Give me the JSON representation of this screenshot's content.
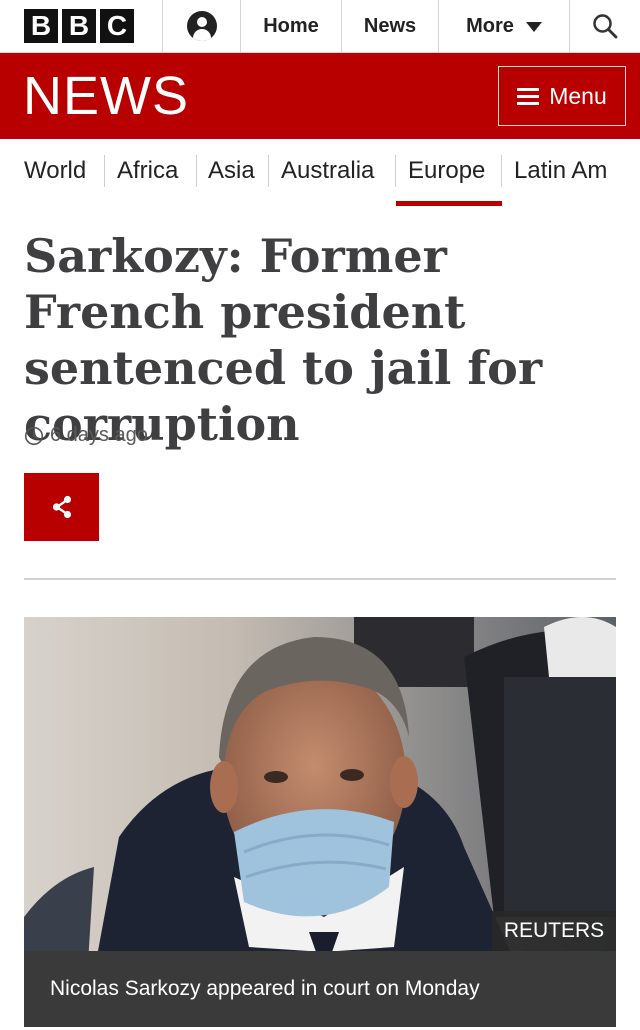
{
  "header": {
    "logo_letters": [
      "B",
      "B",
      "C"
    ],
    "nav": {
      "home": "Home",
      "news": "News",
      "more": "More"
    }
  },
  "newsbar": {
    "title": "NEWS",
    "menu_label": "Menu"
  },
  "regions": {
    "items": [
      "World",
      "Africa",
      "Asia",
      "Australia",
      "Europe",
      "Latin Am"
    ],
    "active": "Europe"
  },
  "article": {
    "headline": "Sarkozy: Former French president sentenced to jail for corruption",
    "timestamp": "6 days ago",
    "image": {
      "credit": "REUTERS",
      "caption": "Nicolas Sarkozy appeared in court on Monday"
    }
  },
  "colors": {
    "brand_red": "#b80000",
    "text_dark": "#3f3f42"
  },
  "icons": [
    "user-icon",
    "chevron-down-icon",
    "search-icon",
    "hamburger-icon",
    "clock-icon",
    "share-icon"
  ]
}
